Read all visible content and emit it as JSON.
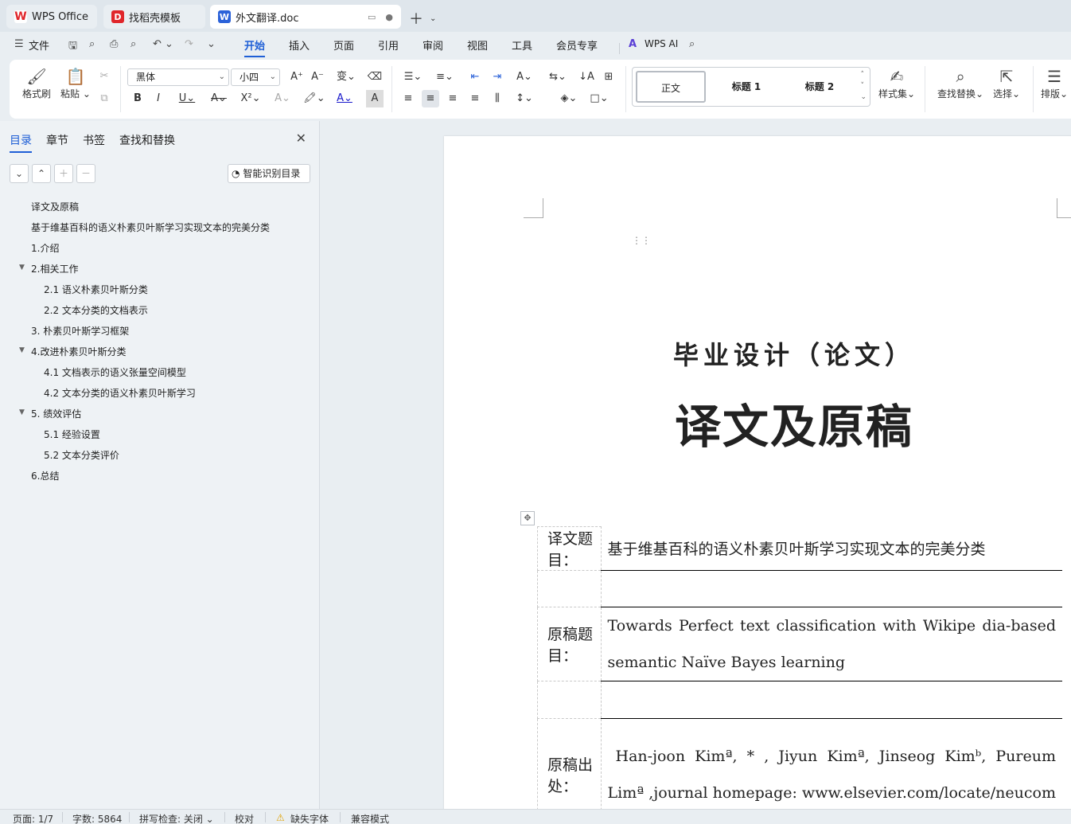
{
  "tabs": [
    {
      "label": "WPS Office",
      "icon": "wps-logo-icon"
    },
    {
      "label": "找稻壳模板",
      "icon": "docer-logo-icon"
    },
    {
      "label": "外文翻译.doc",
      "icon": "word-doc-icon",
      "active": true
    }
  ],
  "menu": {
    "file": "文件",
    "items": [
      "开始",
      "插入",
      "页面",
      "引用",
      "审阅",
      "视图",
      "工具",
      "会员专享"
    ],
    "active": "开始",
    "wps_ai": "WPS AI"
  },
  "ribbon": {
    "format_painter": "格式刷",
    "paste": "粘贴",
    "font_name": "黑体",
    "font_size": "小四",
    "styles": [
      "正文",
      "标题 1",
      "标题 2"
    ],
    "style_set": "样式集",
    "find_replace": "查找替换",
    "select": "选择",
    "layout": "排版"
  },
  "nav": {
    "tabs": [
      "目录",
      "章节",
      "书签",
      "查找和替换"
    ],
    "active_tab": "目录",
    "smart_button": "智能识别目录",
    "toc": [
      {
        "text": "译文及原稿",
        "level": 1
      },
      {
        "text": "基于维基百科的语义朴素贝叶斯学习实现文本的完美分类",
        "level": 1
      },
      {
        "text": "1.介绍",
        "level": 1
      },
      {
        "text": "2.相关工作",
        "level": 1,
        "expanded": true
      },
      {
        "text": "2.1 语义朴素贝叶斯分类",
        "level": 2
      },
      {
        "text": "2.2 文本分类的文档表示",
        "level": 2
      },
      {
        "text": "3. 朴素贝叶斯学习框架",
        "level": 1
      },
      {
        "text": "4.改进朴素贝叶斯分类",
        "level": 1,
        "expanded": true
      },
      {
        "text": "4.1 文档表示的语义张量空间模型",
        "level": 2
      },
      {
        "text": "4.2 文本分类的语义朴素贝叶斯学习",
        "level": 2
      },
      {
        "text": "5. 绩效评估",
        "level": 1,
        "expanded": true
      },
      {
        "text": "5.1 经验设置",
        "level": 2
      },
      {
        "text": "5.2 文本分类评价",
        "level": 2
      },
      {
        "text": "6.总结",
        "level": 1
      }
    ]
  },
  "document": {
    "title_small": "毕业设计（论文）",
    "title_big": "译文及原稿",
    "table": {
      "translated_title_label": "译文题目：",
      "translated_title": "基于维基百科的语义朴素贝叶斯学习实现文本的完美分类",
      "original_title_label": "原稿题目：",
      "original_title_line1": "Towards Perfect text classification with Wikipe dia-based",
      "original_title_line2": "semantic Naïve Bayes learning",
      "source_label": "原稿出处：",
      "source_line1": "Han-joon Kimª, * , Jiyun Kimª, Jinseog Kimᵇ, Pureum",
      "source_line2": "Limª ,journal homepage: www.elsevier.com/locate/neucom"
    }
  },
  "status": {
    "page": "页面: 1/7",
    "words": "字数: 5864",
    "spell": "拼写检查: 关闭",
    "proof": "校对",
    "missing_font": "缺失字体",
    "compat": "兼容模式"
  }
}
